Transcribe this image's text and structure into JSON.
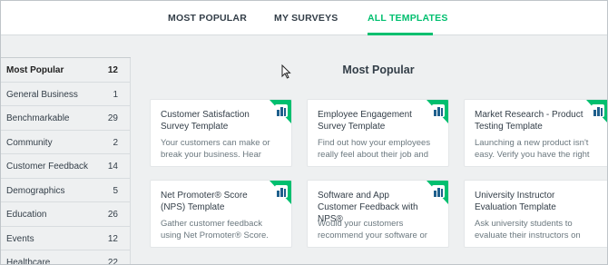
{
  "tabs": [
    {
      "label": "MOST POPULAR",
      "active": false
    },
    {
      "label": "MY SURVEYS",
      "active": false
    },
    {
      "label": "ALL TEMPLATES",
      "active": true
    }
  ],
  "colors": {
    "accent": "#00bf6f",
    "badge_bars": "#1e5f8c"
  },
  "sidebar": {
    "items": [
      {
        "label": "Most Popular",
        "count": "12",
        "active": true
      },
      {
        "label": "General Business",
        "count": "1",
        "active": false
      },
      {
        "label": "Benchmarkable",
        "count": "29",
        "active": false
      },
      {
        "label": "Community",
        "count": "2",
        "active": false
      },
      {
        "label": "Customer Feedback",
        "count": "14",
        "active": false
      },
      {
        "label": "Demographics",
        "count": "5",
        "active": false
      },
      {
        "label": "Education",
        "count": "26",
        "active": false
      },
      {
        "label": "Events",
        "count": "12",
        "active": false
      },
      {
        "label": "Healthcare",
        "count": "22",
        "active": false
      }
    ]
  },
  "main": {
    "section_title": "Most Popular",
    "cards": [
      {
        "title": "Customer Satisfaction Survey Template",
        "description": "Your customers can make or break your business. Hear from…",
        "badge": true
      },
      {
        "title": "Employee Engagement Survey Template",
        "description": "Find out how your employees really feel about their job and g…",
        "badge": true
      },
      {
        "title": "Market Research - Product Testing Template",
        "description": "Launching a new product isn't easy. Verify you have the right a…",
        "badge": true
      },
      {
        "title": "Net Promoter® Score (NPS) Template",
        "description": "Gather customer feedback using Net Promoter® Score. (Net Pro…",
        "badge": true
      },
      {
        "title": "Software and App Customer Feedback with NPS®",
        "description": "Would your customers recommend your software or a…",
        "badge": true
      },
      {
        "title": "University Instructor Evaluation Template",
        "description": "Ask university students to evaluate their instructors on thi…",
        "badge": false
      }
    ]
  },
  "icons": {
    "cursor": "mouse-pointer-icon",
    "badge": "benchmark-badge-icon"
  }
}
